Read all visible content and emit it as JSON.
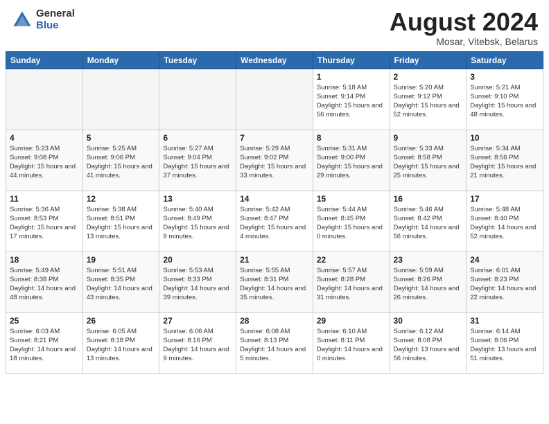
{
  "header": {
    "logo_general": "General",
    "logo_blue": "Blue",
    "month_year": "August 2024",
    "location": "Mosar, Vitebsk, Belarus"
  },
  "days_of_week": [
    "Sunday",
    "Monday",
    "Tuesday",
    "Wednesday",
    "Thursday",
    "Friday",
    "Saturday"
  ],
  "weeks": [
    [
      {
        "day": "",
        "info": ""
      },
      {
        "day": "",
        "info": ""
      },
      {
        "day": "",
        "info": ""
      },
      {
        "day": "",
        "info": ""
      },
      {
        "day": "1",
        "info": "Sunrise: 5:18 AM\nSunset: 9:14 PM\nDaylight: 15 hours\nand 56 minutes."
      },
      {
        "day": "2",
        "info": "Sunrise: 5:20 AM\nSunset: 9:12 PM\nDaylight: 15 hours\nand 52 minutes."
      },
      {
        "day": "3",
        "info": "Sunrise: 5:21 AM\nSunset: 9:10 PM\nDaylight: 15 hours\nand 48 minutes."
      }
    ],
    [
      {
        "day": "4",
        "info": "Sunrise: 5:23 AM\nSunset: 9:08 PM\nDaylight: 15 hours\nand 44 minutes."
      },
      {
        "day": "5",
        "info": "Sunrise: 5:25 AM\nSunset: 9:06 PM\nDaylight: 15 hours\nand 41 minutes."
      },
      {
        "day": "6",
        "info": "Sunrise: 5:27 AM\nSunset: 9:04 PM\nDaylight: 15 hours\nand 37 minutes."
      },
      {
        "day": "7",
        "info": "Sunrise: 5:29 AM\nSunset: 9:02 PM\nDaylight: 15 hours\nand 33 minutes."
      },
      {
        "day": "8",
        "info": "Sunrise: 5:31 AM\nSunset: 9:00 PM\nDaylight: 15 hours\nand 29 minutes."
      },
      {
        "day": "9",
        "info": "Sunrise: 5:33 AM\nSunset: 8:58 PM\nDaylight: 15 hours\nand 25 minutes."
      },
      {
        "day": "10",
        "info": "Sunrise: 5:34 AM\nSunset: 8:56 PM\nDaylight: 15 hours\nand 21 minutes."
      }
    ],
    [
      {
        "day": "11",
        "info": "Sunrise: 5:36 AM\nSunset: 8:53 PM\nDaylight: 15 hours\nand 17 minutes."
      },
      {
        "day": "12",
        "info": "Sunrise: 5:38 AM\nSunset: 8:51 PM\nDaylight: 15 hours\nand 13 minutes."
      },
      {
        "day": "13",
        "info": "Sunrise: 5:40 AM\nSunset: 8:49 PM\nDaylight: 15 hours\nand 9 minutes."
      },
      {
        "day": "14",
        "info": "Sunrise: 5:42 AM\nSunset: 8:47 PM\nDaylight: 15 hours\nand 4 minutes."
      },
      {
        "day": "15",
        "info": "Sunrise: 5:44 AM\nSunset: 8:45 PM\nDaylight: 15 hours\nand 0 minutes."
      },
      {
        "day": "16",
        "info": "Sunrise: 5:46 AM\nSunset: 8:42 PM\nDaylight: 14 hours\nand 56 minutes."
      },
      {
        "day": "17",
        "info": "Sunrise: 5:48 AM\nSunset: 8:40 PM\nDaylight: 14 hours\nand 52 minutes."
      }
    ],
    [
      {
        "day": "18",
        "info": "Sunrise: 5:49 AM\nSunset: 8:38 PM\nDaylight: 14 hours\nand 48 minutes."
      },
      {
        "day": "19",
        "info": "Sunrise: 5:51 AM\nSunset: 8:35 PM\nDaylight: 14 hours\nand 43 minutes."
      },
      {
        "day": "20",
        "info": "Sunrise: 5:53 AM\nSunset: 8:33 PM\nDaylight: 14 hours\nand 39 minutes."
      },
      {
        "day": "21",
        "info": "Sunrise: 5:55 AM\nSunset: 8:31 PM\nDaylight: 14 hours\nand 35 minutes."
      },
      {
        "day": "22",
        "info": "Sunrise: 5:57 AM\nSunset: 8:28 PM\nDaylight: 14 hours\nand 31 minutes."
      },
      {
        "day": "23",
        "info": "Sunrise: 5:59 AM\nSunset: 8:26 PM\nDaylight: 14 hours\nand 26 minutes."
      },
      {
        "day": "24",
        "info": "Sunrise: 6:01 AM\nSunset: 8:23 PM\nDaylight: 14 hours\nand 22 minutes."
      }
    ],
    [
      {
        "day": "25",
        "info": "Sunrise: 6:03 AM\nSunset: 8:21 PM\nDaylight: 14 hours\nand 18 minutes."
      },
      {
        "day": "26",
        "info": "Sunrise: 6:05 AM\nSunset: 8:18 PM\nDaylight: 14 hours\nand 13 minutes."
      },
      {
        "day": "27",
        "info": "Sunrise: 6:06 AM\nSunset: 8:16 PM\nDaylight: 14 hours\nand 9 minutes."
      },
      {
        "day": "28",
        "info": "Sunrise: 6:08 AM\nSunset: 8:13 PM\nDaylight: 14 hours\nand 5 minutes."
      },
      {
        "day": "29",
        "info": "Sunrise: 6:10 AM\nSunset: 8:11 PM\nDaylight: 14 hours\nand 0 minutes."
      },
      {
        "day": "30",
        "info": "Sunrise: 6:12 AM\nSunset: 8:08 PM\nDaylight: 13 hours\nand 56 minutes."
      },
      {
        "day": "31",
        "info": "Sunrise: 6:14 AM\nSunset: 8:06 PM\nDaylight: 13 hours\nand 51 minutes."
      }
    ]
  ]
}
